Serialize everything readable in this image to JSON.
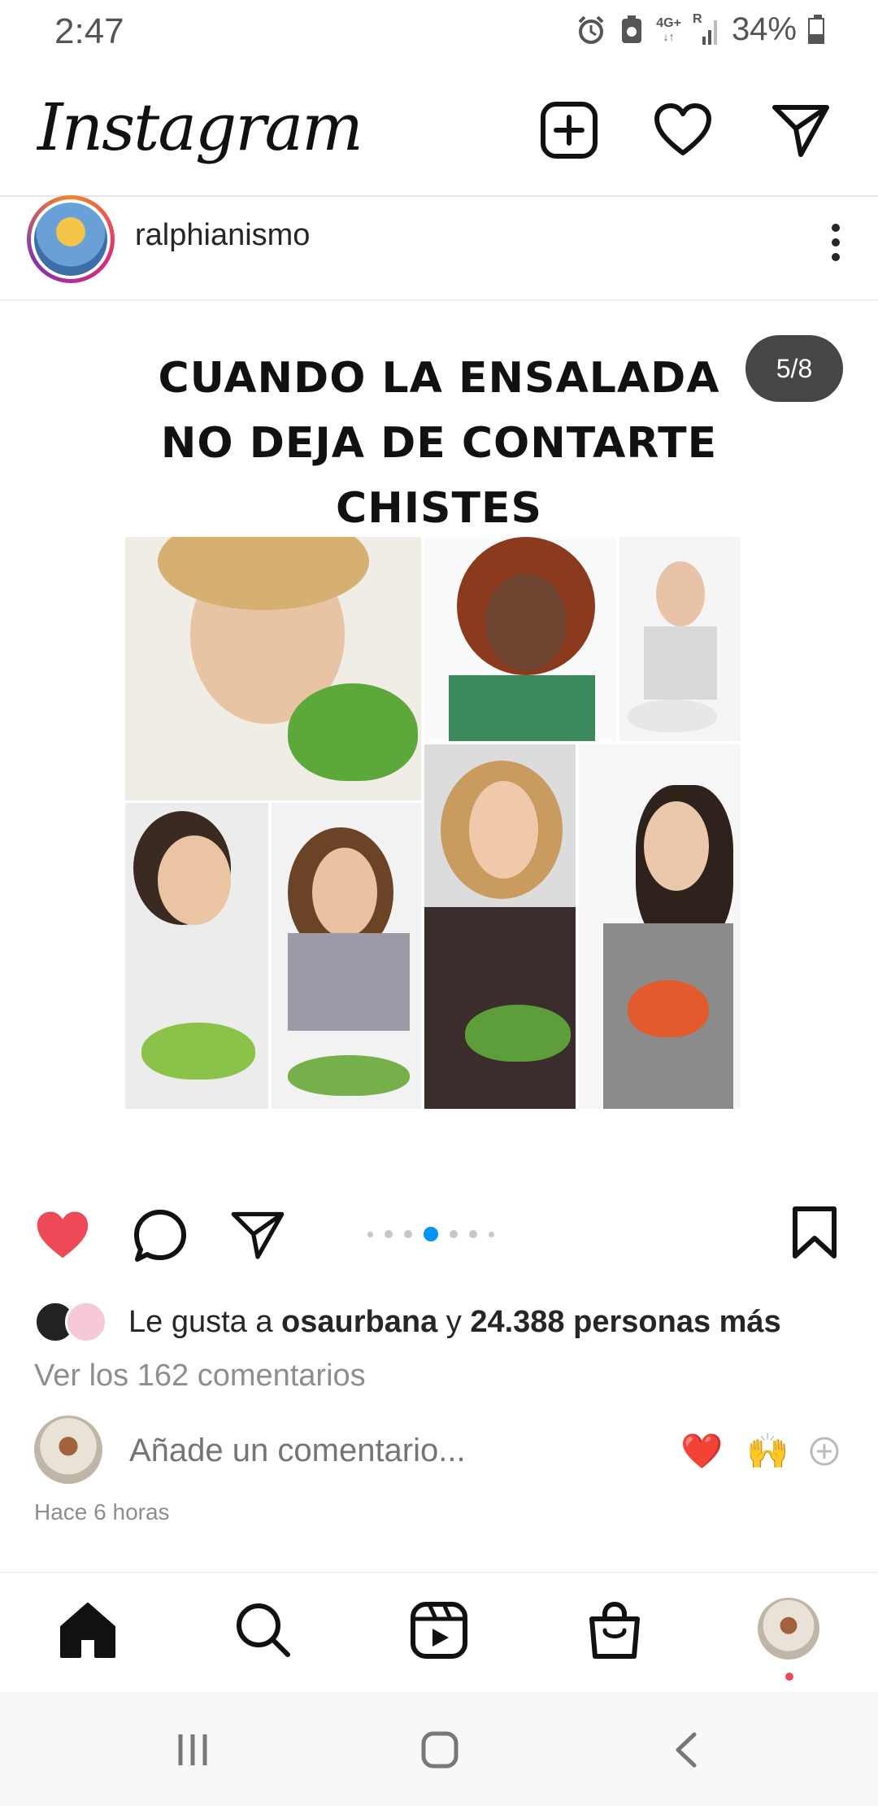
{
  "status_bar": {
    "time": "2:47",
    "network": "4G+",
    "roaming": "R",
    "battery": "34%"
  },
  "header": {
    "title": "Instagram"
  },
  "post": {
    "username": "ralphianismo",
    "meme_text_lines": [
      "CUANDO LA ENSALADA",
      "NO DEJA DE CONTARTE",
      "CHISTES"
    ],
    "carousel_counter": "5/8",
    "liked_prefix": "Le gusta a",
    "liked_by": "osaurbana",
    "liked_connector": "y",
    "liked_others": "24.388 personas más",
    "view_comments": "Ver los 162 comentarios",
    "comment_placeholder": "Añade un comentario...",
    "quick_reactions": [
      "❤️",
      "🙌"
    ],
    "time_ago": "Hace 6 horas"
  },
  "colors": {
    "like_red": "#ed4956",
    "accent_blue": "#0095f6",
    "text": "#262626",
    "muted": "#8e8e8e"
  },
  "bottom_nav": [
    "home-icon",
    "search-icon",
    "reels-icon",
    "shop-icon",
    "profile-avatar"
  ]
}
